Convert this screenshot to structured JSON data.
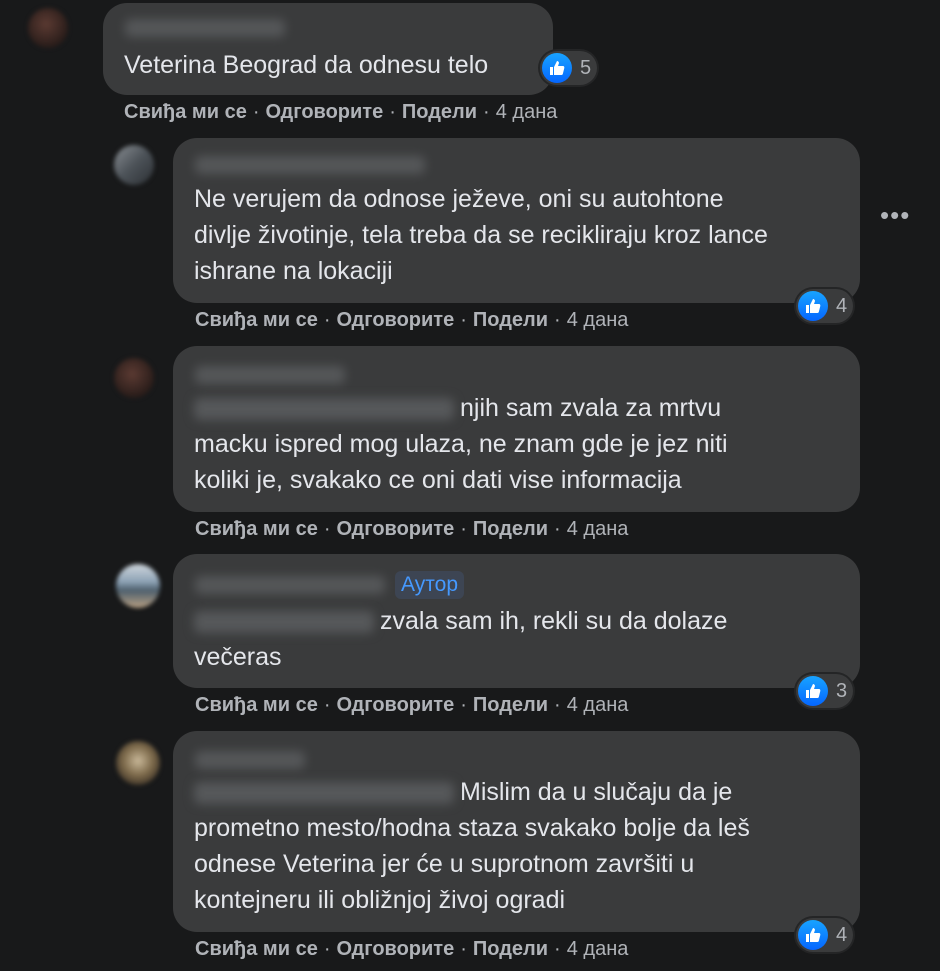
{
  "actions": {
    "like": "Свиђа ми се",
    "reply": "Одговорите",
    "share": "Подели",
    "sep": "·"
  },
  "comments": [
    {
      "text": "Veterina Beograd da odnesu telo",
      "likes": "5",
      "time": "4 дана"
    },
    {
      "lines": [
        "Ne verujem da odnose ježeve, oni su autohtone",
        "divlje životinje, tela treba da se recikliraju kroz lance",
        "ishrane na lokaciji"
      ],
      "likes": "4",
      "time": "4 дана"
    },
    {
      "lines": [
        "njih sam zvala za mrtvu",
        "macku ispred mog ulaza, ne znam gde je jez niti",
        "koliki je, svakako ce oni dati vise informacija"
      ],
      "time": "4 дана"
    },
    {
      "author_badge": "Аутор",
      "lines": [
        "zvala sam ih, rekli su da dolaze",
        "večeras"
      ],
      "likes": "3",
      "time": "4 дана"
    },
    {
      "lines": [
        "Mislim da u slučaju da je",
        "prometno mesto/hodna staza svakako bolje da leš",
        "odnese Veterina jer će u suprotnom završiti u",
        "kontejneru ili obližnjoj živoj ogradi"
      ],
      "likes": "4",
      "time": "4 дана"
    }
  ],
  "icons": {
    "like": "thumbs-up-icon",
    "more": "more-horizontal-icon"
  },
  "colors": {
    "background": "#18191a",
    "bubble": "#3a3b3c",
    "like_blue": "#1877f2",
    "author_badge": "#4599ff"
  }
}
